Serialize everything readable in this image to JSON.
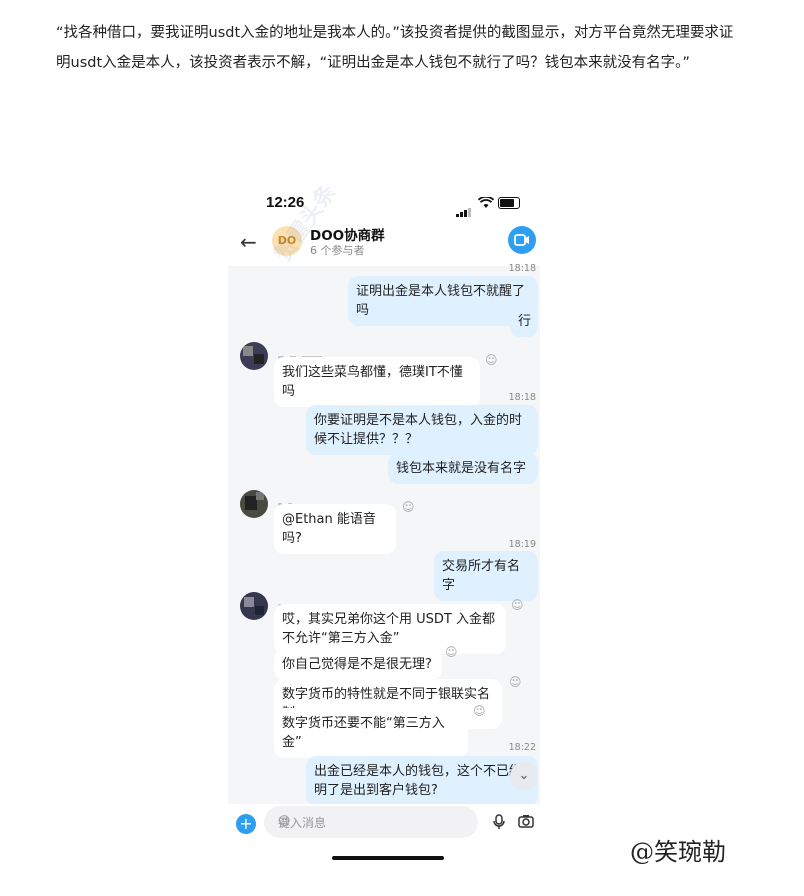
{
  "article": {
    "text": "“找各种借口，要我证明usdt入金的地址是我本人的。”该投资者提供的截图显示，对方平台竟然无理要求证明usdt入金是本人，该投资者表示不解，“证明出金是本人钱包不就行了吗？钱包本来就没有名字。”"
  },
  "status_bar": {
    "time": "12:26"
  },
  "chat_header": {
    "avatar_text": "DO",
    "group_name": "DOO协商群",
    "members": "6 个参与者"
  },
  "messages": {
    "ts1": "18:18",
    "m1": "证明出金是本人钱包不就醒了吗",
    "m2": "行",
    "m3": "我们这些菜鸟都懂，德璞IT不懂吗",
    "ts2": "18:18",
    "m4": "你要证明是不是本人钱包，入金的时候不让提供？？？",
    "m5": "钱包本来就是没有名字",
    "m6": "@Ethan 能语音吗?",
    "ts3": "18:19",
    "m7": "交易所才有名字",
    "m8": "哎，其实兄弟你这个用 USDT 入金都不允许“第三方入金”",
    "m9": "你自己觉得是不是很无理?",
    "m10": "数字货币的特性就是不同于银联实名制",
    "m11": "数字货币还要不能“第三方入金”",
    "ts4": "18:22",
    "m12": "出金已经是本人的钱包，这个不已经明了是出到客户钱包?"
  },
  "input": {
    "placeholder": "键入消息"
  },
  "watermark": "赞雷头条",
  "brand": "@笑琬勒",
  "icons": {
    "back": "arrow-left-icon",
    "call": "video-call-icon",
    "plus": "plus-icon",
    "emoji": "emoji-icon",
    "mic": "microphone-icon",
    "camera": "camera-icon",
    "reaction": "smiley-reaction-icon",
    "scroll": "chevron-down-icon"
  },
  "colors": {
    "accent": "#2e9ff0",
    "outgoing_bubble": "#dff0ff",
    "avatar_do": "#fbe1b3"
  }
}
